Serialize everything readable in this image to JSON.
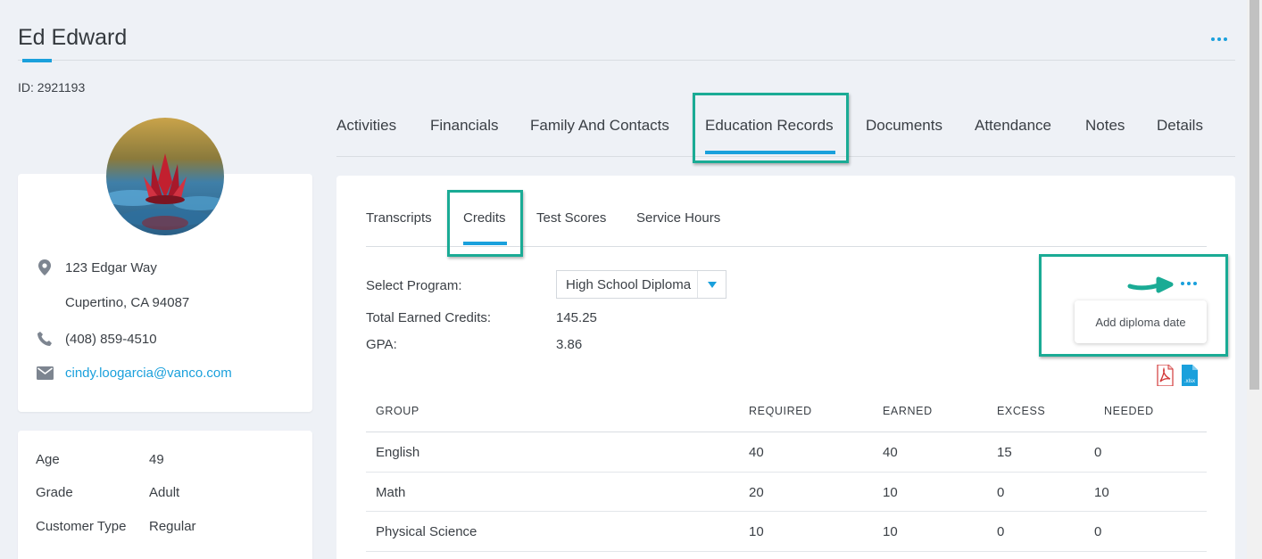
{
  "header": {
    "title": "Ed Edward",
    "id_label": "ID: 2921193"
  },
  "contact": {
    "address_line1": "123 Edgar Way",
    "address_line2": "Cupertino, CA 94087",
    "phone": "(408) 859-4510",
    "email": "cindy.loogarcia@vanco.com"
  },
  "details": {
    "rows": [
      {
        "label": "Age",
        "value": "49"
      },
      {
        "label": "Grade",
        "value": "Adult"
      },
      {
        "label": "Customer Type",
        "value": "Regular"
      }
    ]
  },
  "main_tabs": [
    {
      "label": "Activities"
    },
    {
      "label": "Financials"
    },
    {
      "label": "Family And Contacts"
    },
    {
      "label": "Education Records",
      "active": true
    },
    {
      "label": "Documents"
    },
    {
      "label": "Attendance"
    },
    {
      "label": "Notes"
    },
    {
      "label": "Details"
    }
  ],
  "sub_tabs": [
    {
      "label": "Transcripts"
    },
    {
      "label": "Credits",
      "active": true
    },
    {
      "label": "Test Scores"
    },
    {
      "label": "Service Hours"
    }
  ],
  "credits": {
    "select_program_label": "Select Program:",
    "select_program_value": "High School Diploma",
    "total_earned_label": "Total Earned Credits:",
    "total_earned_value": "145.25",
    "gpa_label": "GPA:",
    "gpa_value": "3.86",
    "menu_item": "Add diploma date",
    "export_icons": [
      "pdf-icon",
      "xlsx-icon"
    ],
    "xlsx_text": ".xlsx"
  },
  "table": {
    "headers": [
      "GROUP",
      "REQUIRED",
      "EARNED",
      "EXCESS",
      "NEEDED"
    ],
    "rows": [
      [
        "English",
        "40",
        "40",
        "15",
        "0"
      ],
      [
        "Math",
        "20",
        "10",
        "0",
        "10"
      ],
      [
        "Physical Science",
        "10",
        "10",
        "0",
        "0"
      ]
    ]
  },
  "colors": {
    "accent": "#1aa0dc",
    "highlight": "#1aab95",
    "background": "#eef1f6"
  }
}
